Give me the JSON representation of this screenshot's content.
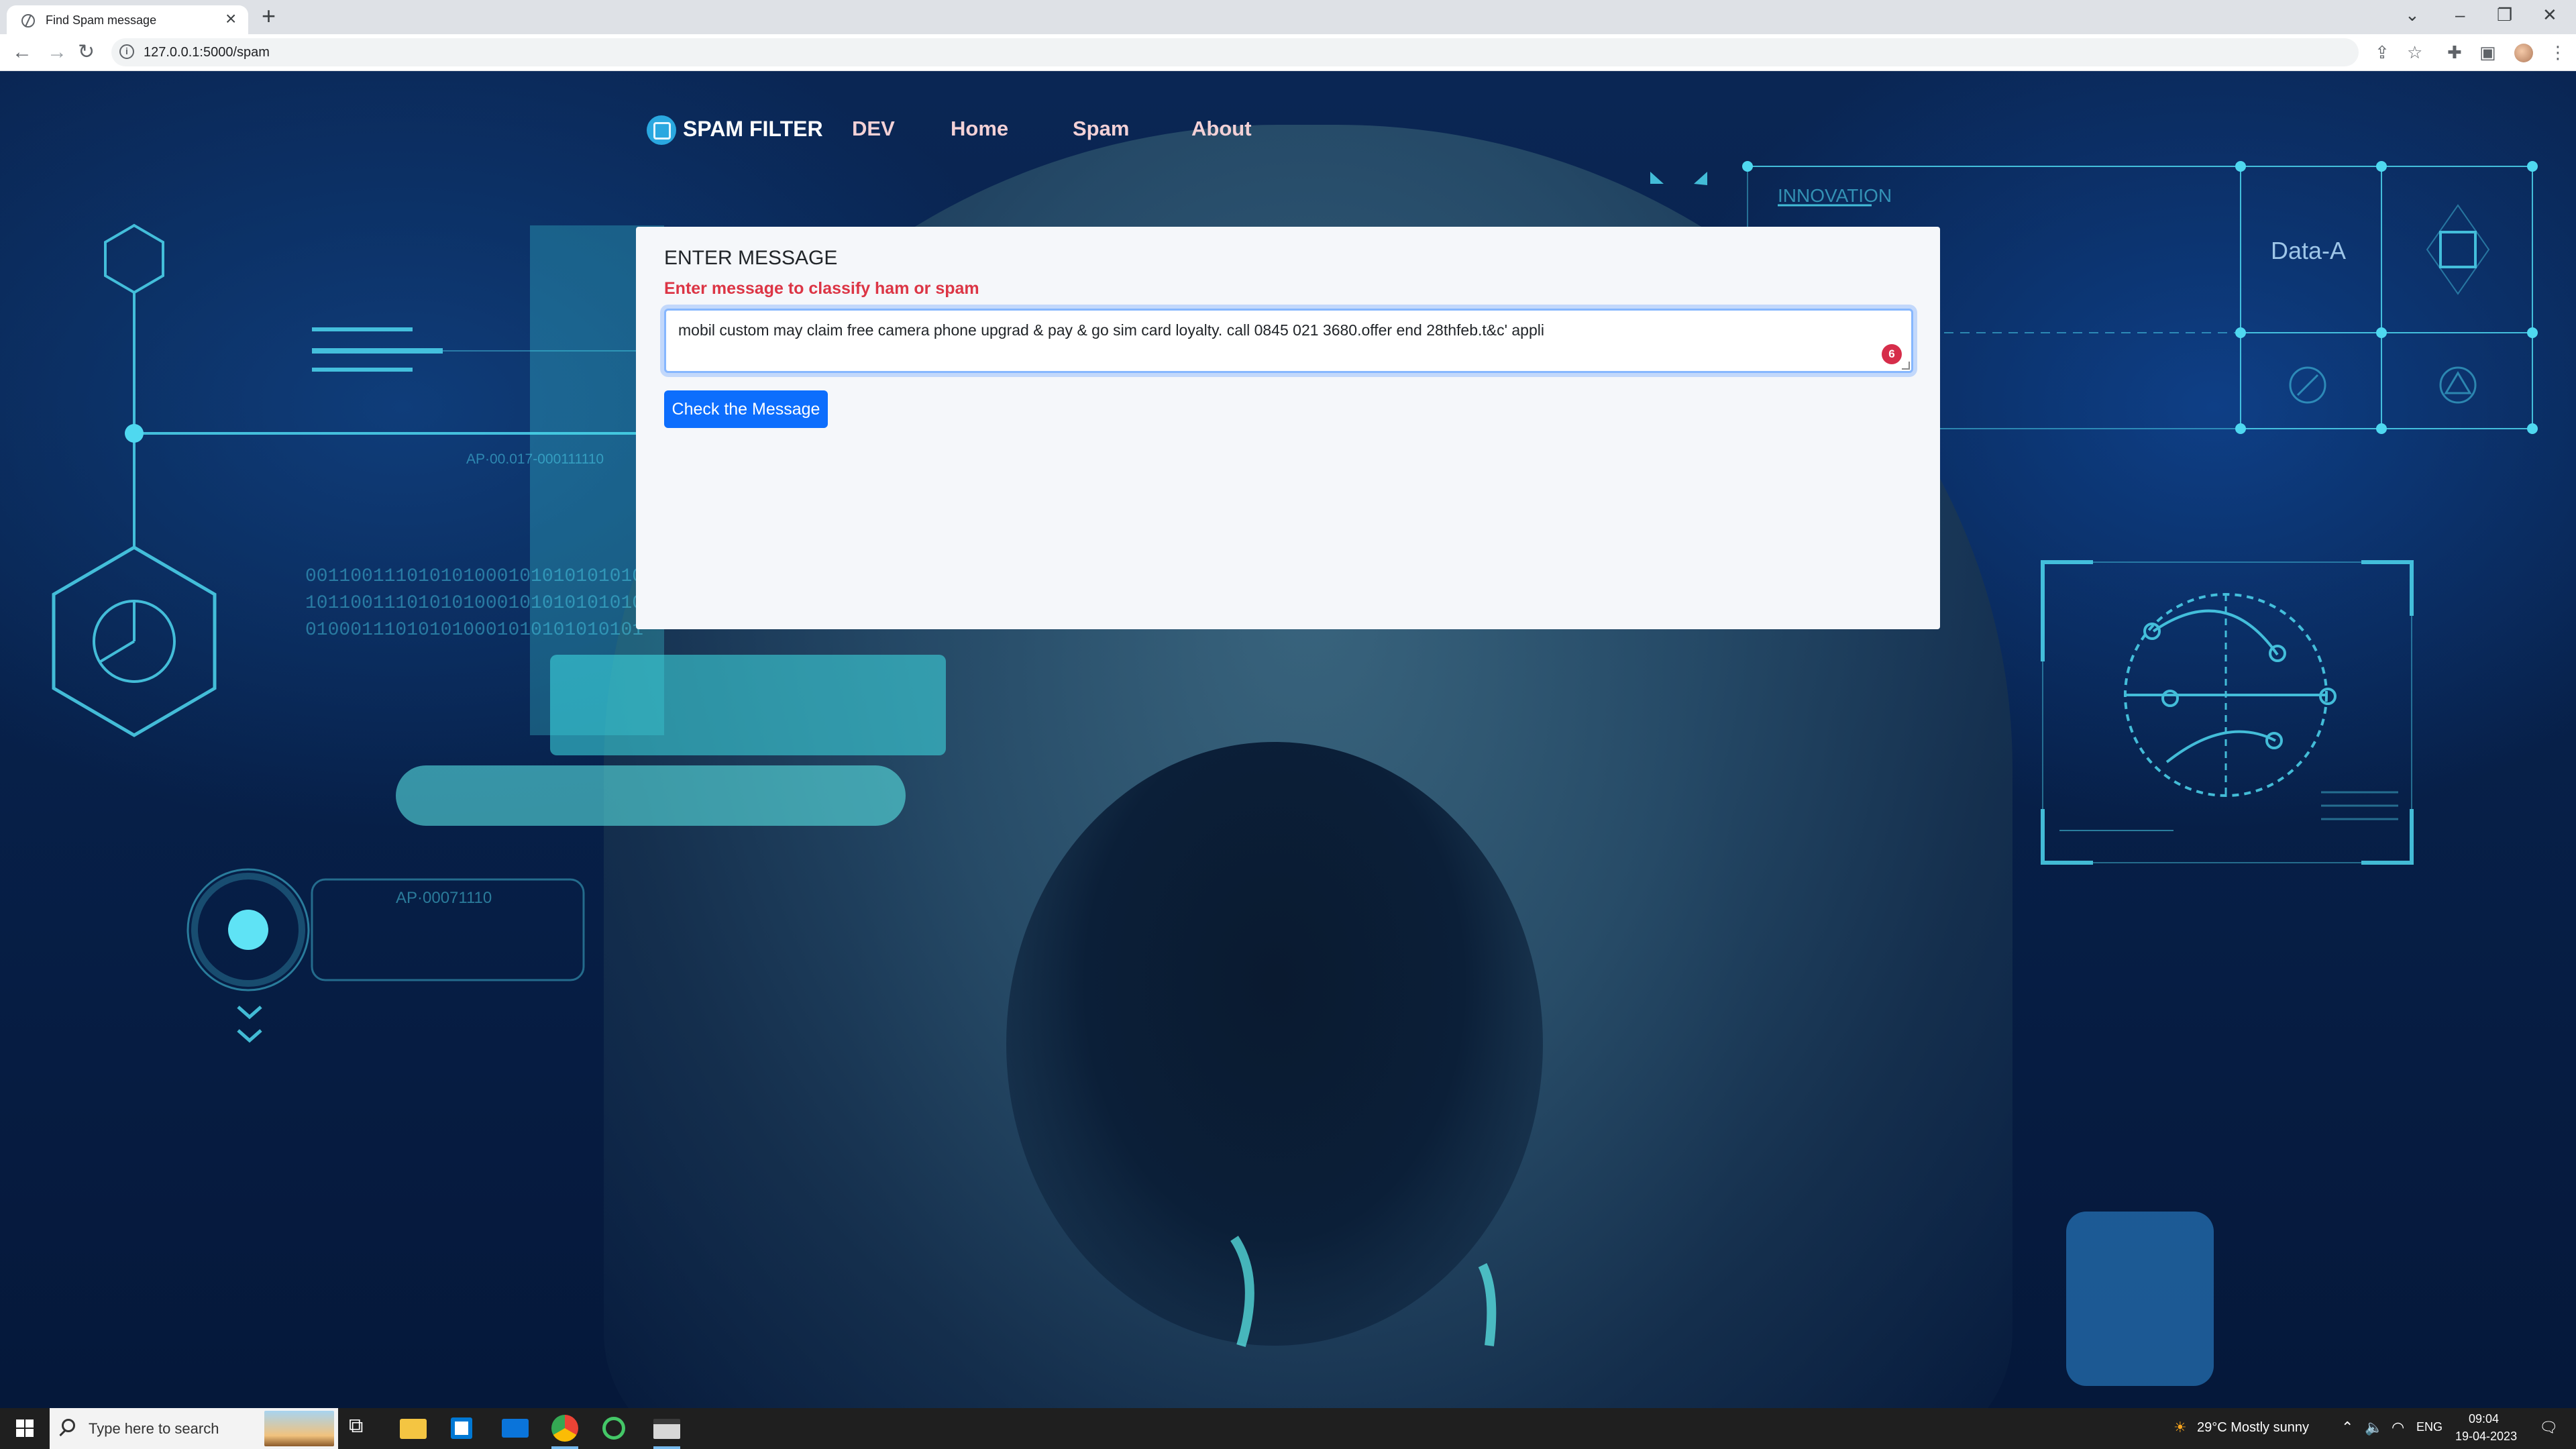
{
  "browser": {
    "tab_title": "Find Spam message",
    "url": "127.0.0.1:5000/spam",
    "icons": [
      "globe-icon",
      "close-icon",
      "plus-icon",
      "back-icon",
      "forward-icon",
      "reload-icon",
      "info-icon",
      "share-icon",
      "star-icon",
      "extensions-icon",
      "sidepanel-icon",
      "profile-avatar",
      "menu-icon"
    ]
  },
  "navbar": {
    "brand": "SPAM FILTER",
    "links": [
      "DEV",
      "Home",
      "Spam",
      "About"
    ]
  },
  "card": {
    "title": "ENTER MESSAGE",
    "subtitle": "Enter message to classify ham or spam",
    "message_value": "mobil custom may claim free camera phone upgrad & pay & go sim card loyalty. call 0845 021 3680.offer end 28thfeb.t&c' appli",
    "grammarly_count": "6",
    "button_label": "Check the Message"
  },
  "background": {
    "hud_texts": [
      "INNOVATION",
      "Data-A",
      "AP·00071110",
      "AP·00.017-000111110",
      "001100111010101000101010101010",
      "101100111010101000101010101010",
      "010001110101010001010101010101"
    ]
  },
  "taskbar": {
    "search_placeholder": "Type here to search",
    "weather": "29°C  Mostly sunny",
    "language": "ENG",
    "time": "09:04",
    "date": "19-04-2023"
  },
  "colors": {
    "primary_button": "#0d6efd",
    "subtitle_red": "#dc3545",
    "nav_link": "#f3d1d6",
    "hud_cyan": "#4fd8f0"
  }
}
